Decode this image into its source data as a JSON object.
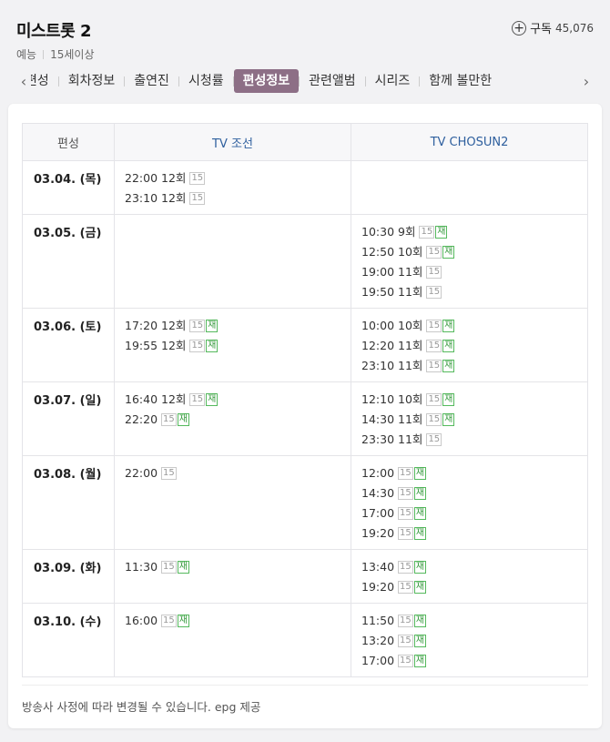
{
  "header": {
    "title": "미스트롯 2",
    "subscribe_label": "구독",
    "subscribe_count": "45,076",
    "genre": "예능",
    "rating": "15세이상"
  },
  "tabs": [
    {
      "label": "편성"
    },
    {
      "label": "회차정보"
    },
    {
      "label": "출연진"
    },
    {
      "label": "시청률"
    },
    {
      "label": "편성정보",
      "active": true
    },
    {
      "label": "관련앨범"
    },
    {
      "label": "시리즈"
    },
    {
      "label": "함께 볼만한"
    }
  ],
  "schedule": {
    "headers": [
      "편성",
      "TV 조선",
      "TV CHOSUN2"
    ],
    "badge_age": "15",
    "badge_rerun": "재",
    "rows": [
      {
        "date": "03.04. (목)",
        "ch1": [
          {
            "time": "22:00",
            "ep": "12회",
            "re": false
          },
          {
            "time": "23:10",
            "ep": "12회",
            "re": false
          }
        ],
        "ch2": []
      },
      {
        "date": "03.05. (금)",
        "ch1": [],
        "ch2": [
          {
            "time": "10:30",
            "ep": "9회",
            "re": true
          },
          {
            "time": "12:50",
            "ep": "10회",
            "re": true
          },
          {
            "time": "19:00",
            "ep": "11회",
            "re": false
          },
          {
            "time": "19:50",
            "ep": "11회",
            "re": false
          }
        ]
      },
      {
        "date": "03.06. (토)",
        "ch1": [
          {
            "time": "17:20",
            "ep": "12회",
            "re": true
          },
          {
            "time": "19:55",
            "ep": "12회",
            "re": true
          }
        ],
        "ch2": [
          {
            "time": "10:00",
            "ep": "10회",
            "re": true
          },
          {
            "time": "12:20",
            "ep": "11회",
            "re": true
          },
          {
            "time": "23:10",
            "ep": "11회",
            "re": true
          }
        ]
      },
      {
        "date": "03.07. (일)",
        "ch1": [
          {
            "time": "16:40",
            "ep": "12회",
            "re": true
          },
          {
            "time": "22:20",
            "ep": "",
            "re": true
          }
        ],
        "ch2": [
          {
            "time": "12:10",
            "ep": "10회",
            "re": true
          },
          {
            "time": "14:30",
            "ep": "11회",
            "re": true
          },
          {
            "time": "23:30",
            "ep": "11회",
            "re": false
          }
        ]
      },
      {
        "date": "03.08. (월)",
        "ch1": [
          {
            "time": "22:00",
            "ep": "",
            "re": false
          }
        ],
        "ch2": [
          {
            "time": "12:00",
            "ep": "",
            "re": true
          },
          {
            "time": "14:30",
            "ep": "",
            "re": true
          },
          {
            "time": "17:00",
            "ep": "",
            "re": true
          },
          {
            "time": "19:20",
            "ep": "",
            "re": true
          }
        ]
      },
      {
        "date": "03.09. (화)",
        "ch1": [
          {
            "time": "11:30",
            "ep": "",
            "re": true
          }
        ],
        "ch2": [
          {
            "time": "13:40",
            "ep": "",
            "re": true
          },
          {
            "time": "19:20",
            "ep": "",
            "re": true
          }
        ]
      },
      {
        "date": "03.10. (수)",
        "ch1": [
          {
            "time": "16:00",
            "ep": "",
            "re": true
          }
        ],
        "ch2": [
          {
            "time": "11:50",
            "ep": "",
            "re": true
          },
          {
            "time": "13:20",
            "ep": "",
            "re": true
          },
          {
            "time": "17:00",
            "ep": "",
            "re": true
          }
        ]
      }
    ]
  },
  "footnote": "방송사 사정에 따라 변경될 수 있습니다. epg 제공",
  "colors": {
    "active_tab": "#8d6f86",
    "channel_header": "#2e5f9e",
    "rerun_badge": "#3a9c41"
  }
}
